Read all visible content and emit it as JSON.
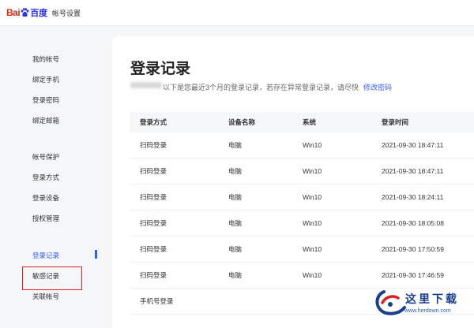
{
  "header": {
    "logo_bai": "Bai",
    "logo_du": "百度",
    "title": "帐号设置"
  },
  "sidebar": {
    "items": [
      {
        "label": "我的帐号"
      },
      {
        "label": "绑定手机"
      },
      {
        "label": "登录密码"
      },
      {
        "label": "绑定邮箱"
      },
      {
        "label": "帐号保护"
      },
      {
        "label": "登录方式"
      },
      {
        "label": "登录设备"
      },
      {
        "label": "授权管理"
      },
      {
        "label": "登录记录"
      },
      {
        "label": "敏感记录"
      },
      {
        "label": "关联帐号"
      }
    ],
    "active_index": 8
  },
  "main": {
    "title": "登录记录",
    "desc": "以下是您最近3个月的登录记录，若存在异常登录记录，请尽快",
    "desc_link": "修改密码",
    "table": {
      "headers": [
        "登录方式",
        "设备名称",
        "系统",
        "登录时间"
      ],
      "rows": [
        [
          "扫码登录",
          "电脑",
          "Win10",
          "2021-09-30 18:47:11"
        ],
        [
          "扫码登录",
          "电脑",
          "Win10",
          "2021-09-30 18:47:11"
        ],
        [
          "扫码登录",
          "电脑",
          "Win10",
          "2021-09-30 18:24:11"
        ],
        [
          "扫码登录",
          "电脑",
          "Win10",
          "2021-09-30 18:05:08"
        ],
        [
          "扫码登录",
          "电脑",
          "Win10",
          "2021-09-30 17:50:59"
        ],
        [
          "扫码登录",
          "电脑",
          "Win10",
          "2021-09-30 17:46:59"
        ]
      ],
      "section_label": "手机号登录"
    }
  },
  "watermark": {
    "text": "这里下载",
    "url": "www.herdown.com"
  },
  "colors": {
    "accent": "#315efb",
    "highlight_box": "#e02020",
    "brand_red": "#de2910",
    "brand_blue": "#2932e1"
  }
}
